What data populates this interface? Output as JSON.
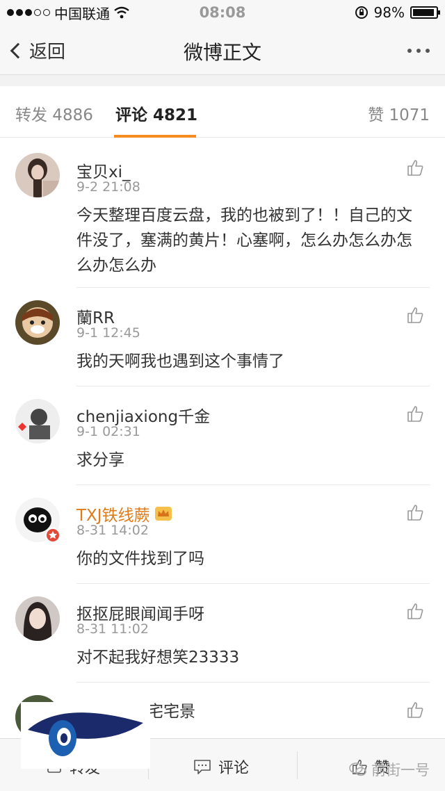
{
  "status": {
    "carrier": "中国联通",
    "time": "08:08",
    "battery": "98%"
  },
  "nav": {
    "back": "返回",
    "title": "微博正文"
  },
  "tabs": {
    "repost": "转发 4886",
    "comment": "评论 4821",
    "likes": "赞 1071"
  },
  "comments": [
    {
      "user": "宝贝xi_",
      "time": "9-2 21:08",
      "text": "今天整理百度云盘，我的也被到了！！自己的文件没了，塞满的黄片！心塞啊，怎么办怎么办怎么办怎么办"
    },
    {
      "user": "蘭RR",
      "time": "9-1 12:45",
      "text": "我的天啊我也遇到这个事情了"
    },
    {
      "user": "chenjiaxiong千金",
      "time": "9-1 02:31",
      "text": "求分享"
    },
    {
      "user": "TXJ铁线蕨",
      "time": "8-31 14:02",
      "text": "你的文件找到了吗"
    },
    {
      "user": "抠抠屁眼闻闻手呀",
      "time": "8-31 11:02",
      "text": "对不起我好想笑23333"
    },
    {
      "user": "宅宅景",
      "time": "",
      "text": ""
    }
  ],
  "bottom": {
    "repost": "转发",
    "comment": "评论",
    "like": "赞"
  },
  "watermark": {
    "text": "前街一号"
  },
  "colors": {
    "accent": "#f68b1f",
    "vip_name": "#e07b1a"
  }
}
